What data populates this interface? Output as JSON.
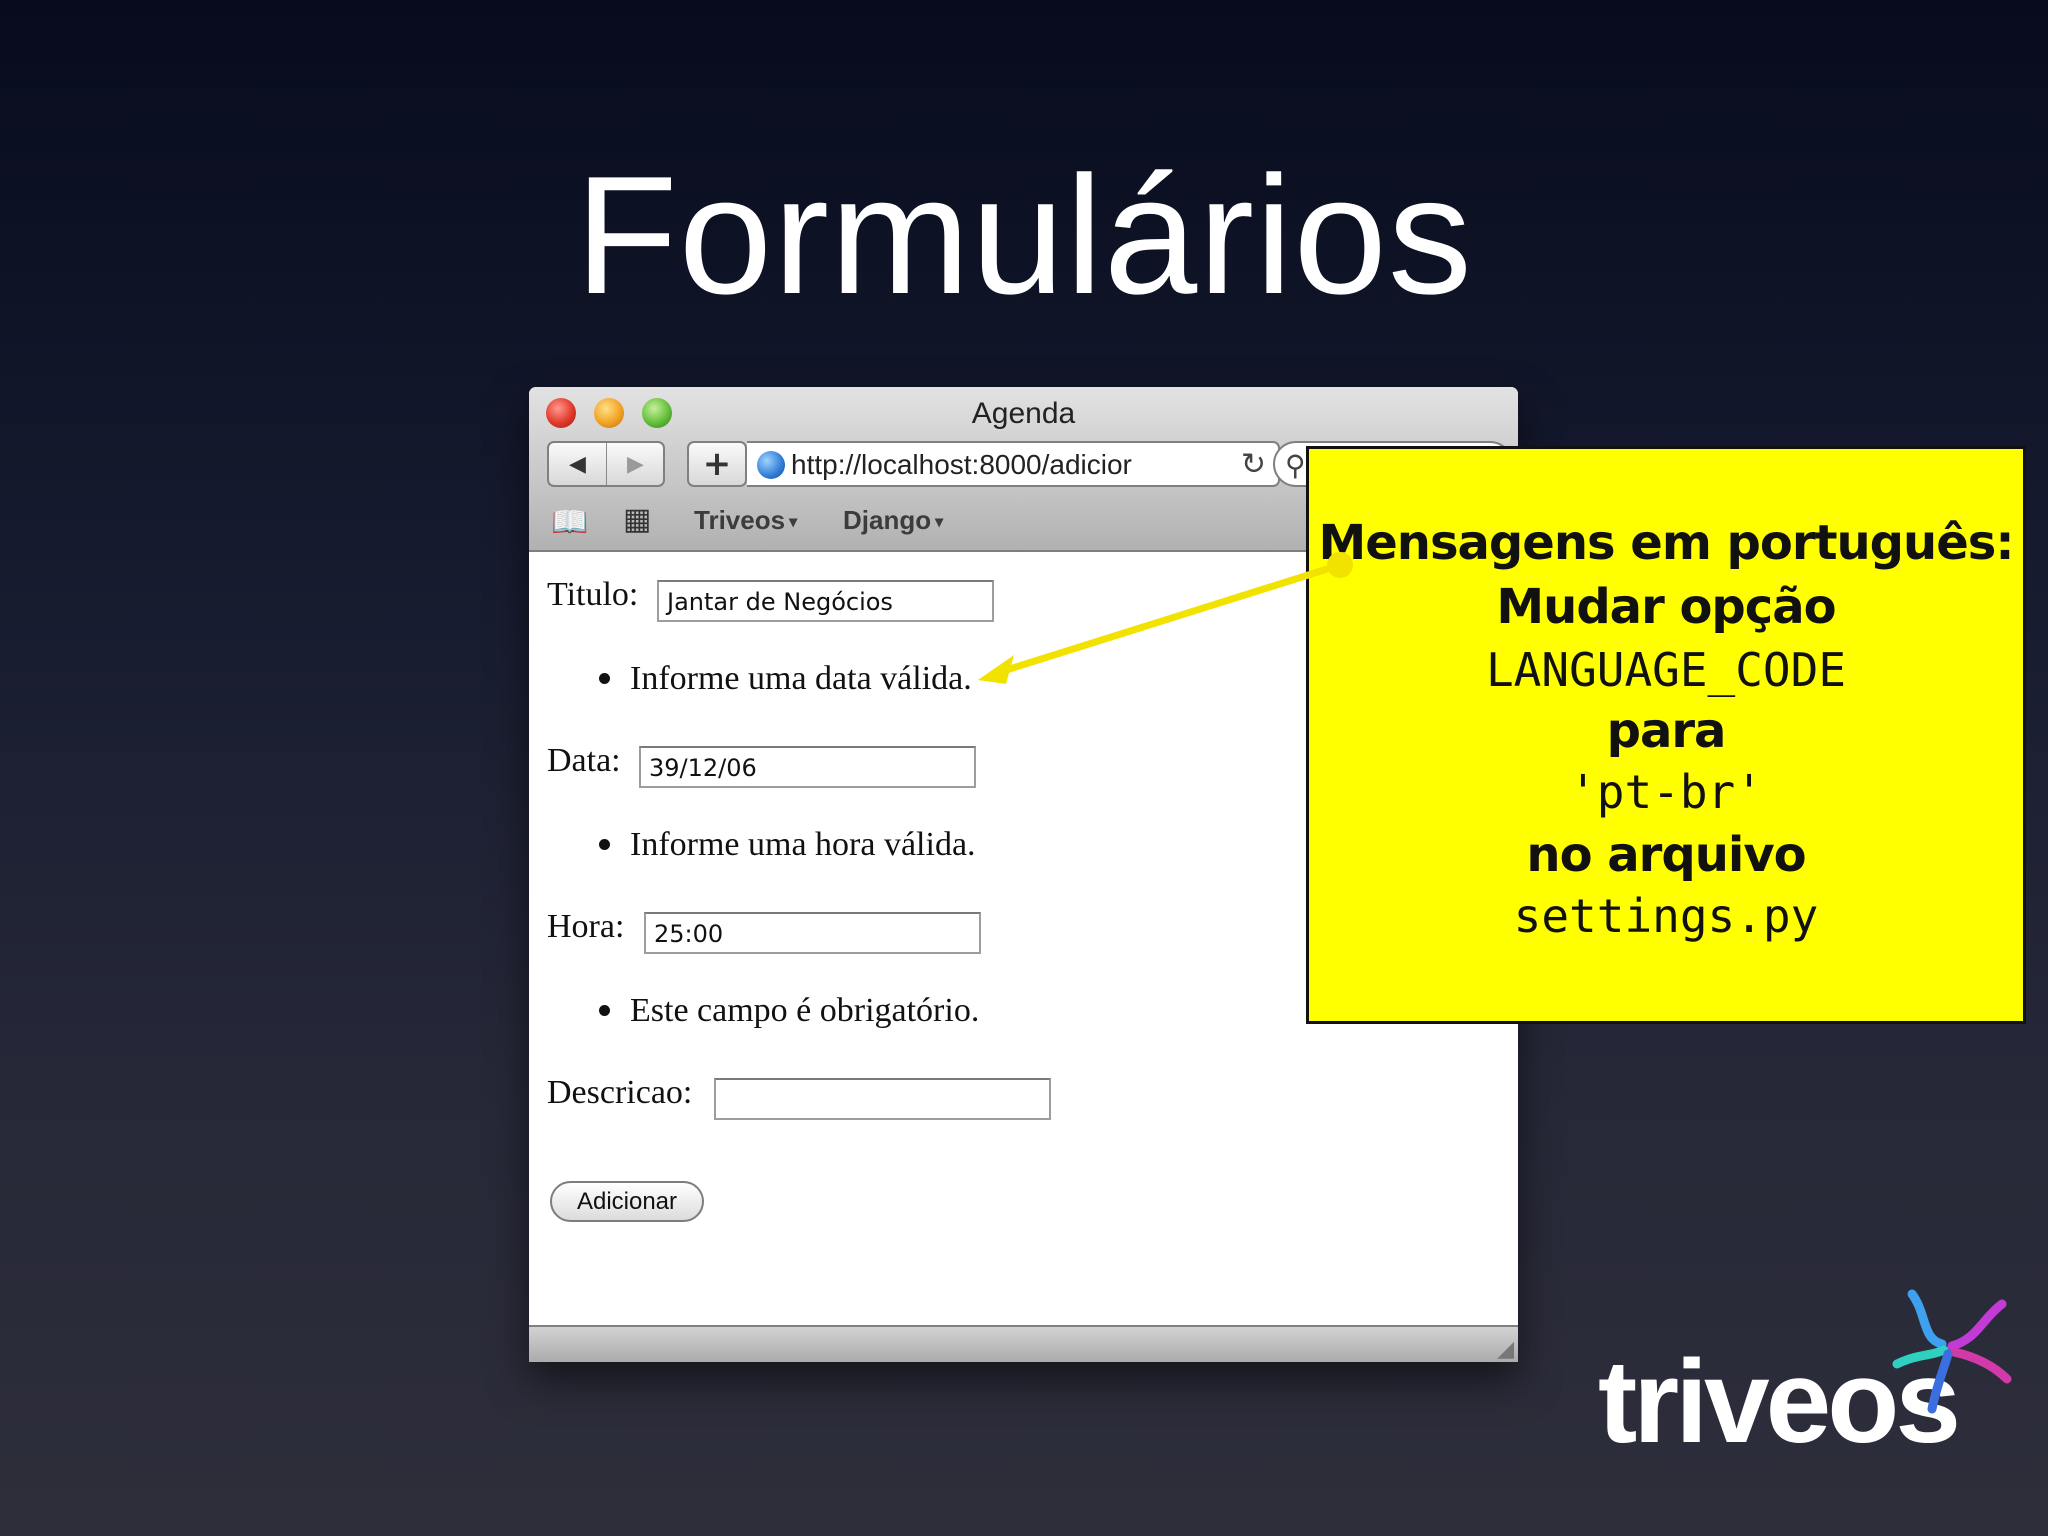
{
  "slide": {
    "title": "Formulários"
  },
  "browser": {
    "window_title": "Agenda",
    "back_glyph": "◀",
    "forward_glyph": "▶",
    "add_glyph": "+",
    "url": "http://localhost:8000/adicior",
    "bookmarks": [
      {
        "label": "Triveos"
      },
      {
        "label": "Django"
      }
    ],
    "arrow_glyph": "▾"
  },
  "form": {
    "titulo": {
      "label": "Titulo:",
      "value": "Jantar de Negócios"
    },
    "data_error": "Informe uma data válida.",
    "data": {
      "label": "Data:",
      "value": "39/12/06"
    },
    "hora_error": "Informe uma hora válida.",
    "hora": {
      "label": "Hora:",
      "value": "25:00"
    },
    "descricao_error": "Este campo é obrigatório.",
    "descricao": {
      "label": "Descricao:",
      "value": ""
    },
    "submit_label": "Adicionar"
  },
  "callout": {
    "line1": "Mensagens em português:",
    "line2": "Mudar opção",
    "line3": "LANGUAGE_CODE",
    "line4": "para",
    "line5": "'pt-br'",
    "line6": "no arquivo",
    "line7": "settings.py",
    "background_color": "#ffff00",
    "arrow_color": "#f2e200"
  },
  "logo": {
    "text": "triveos"
  }
}
